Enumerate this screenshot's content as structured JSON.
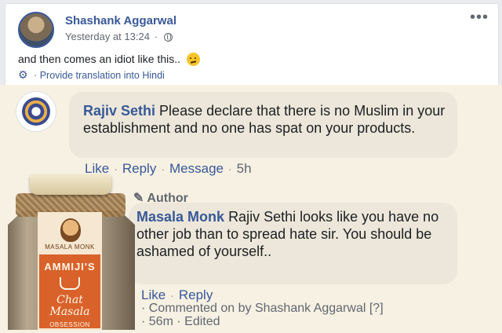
{
  "post": {
    "author": "Shashank Aggarwal",
    "timestamp": "Yesterday at 13:24",
    "text": "and then comes an idiot like this..",
    "translate_link": "Provide translation into Hindi",
    "more_label": "•••"
  },
  "comments": [
    {
      "author": "Rajiv Sethi",
      "text": "Please declare that there is no Muslim in your establishment and no one has spat on your products.",
      "actions": {
        "like": "Like",
        "reply": "Reply",
        "message": "Message",
        "time": "5h"
      }
    },
    {
      "badge": "Author",
      "author": "Masala Monk",
      "text": "Rajiv Sethi looks like you have no other job than to spread hate sir. You should be ashamed of yourself..",
      "actions": {
        "like": "Like",
        "reply": "Reply"
      },
      "commented_on": "Commented on by Shashank Aggarwal",
      "help_link": "[?]",
      "time": "56m",
      "edited": "Edited"
    }
  ],
  "product_jar": {
    "brand": "MASALA MONK",
    "name": "AMMIJI'S",
    "product": "Chat Masala",
    "sub": "OBSESSION"
  },
  "colors": {
    "link_blue": "#385898",
    "comment_bg": "#f7f1e3",
    "bubble_bg": "#ece7da",
    "label_orange": "#d9622a"
  },
  "icons": [
    "globe-icon",
    "more-icon",
    "gear-icon",
    "confused-emoji-icon",
    "pencil-icon"
  ]
}
